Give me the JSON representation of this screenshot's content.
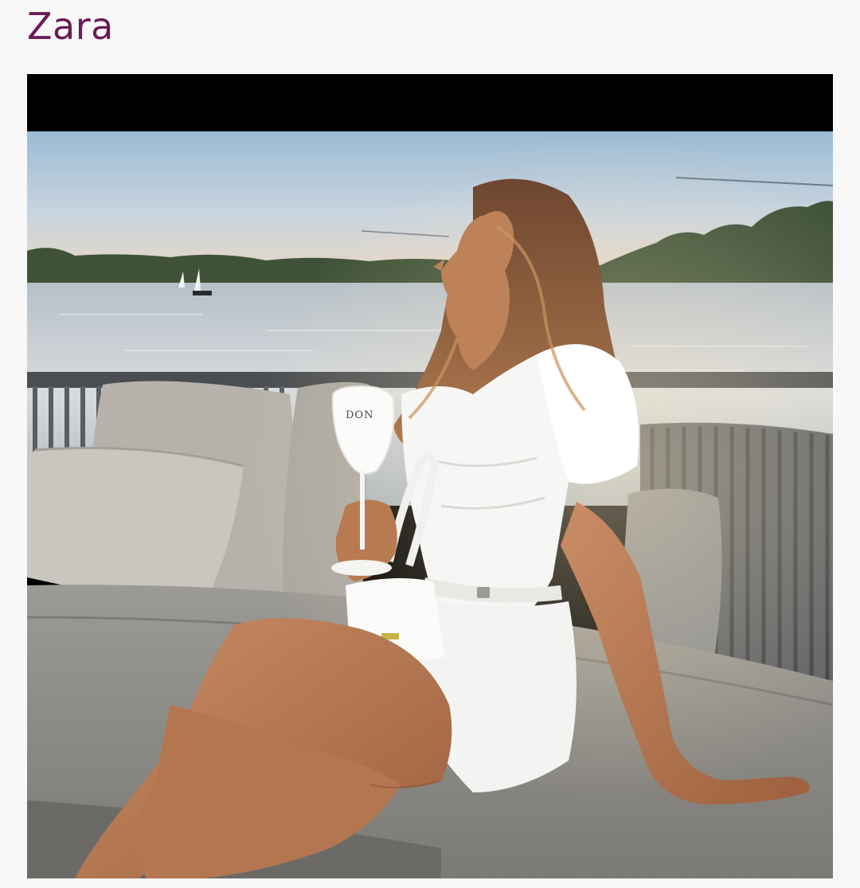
{
  "header": {
    "title": "Zara"
  },
  "photo": {
    "glass_print": "DON"
  },
  "colors": {
    "title": "#6a1b55",
    "background": "#f8f8f9",
    "letterbox": "#000000",
    "dress": "#f6f6f4",
    "water": "#c8cfd4"
  }
}
